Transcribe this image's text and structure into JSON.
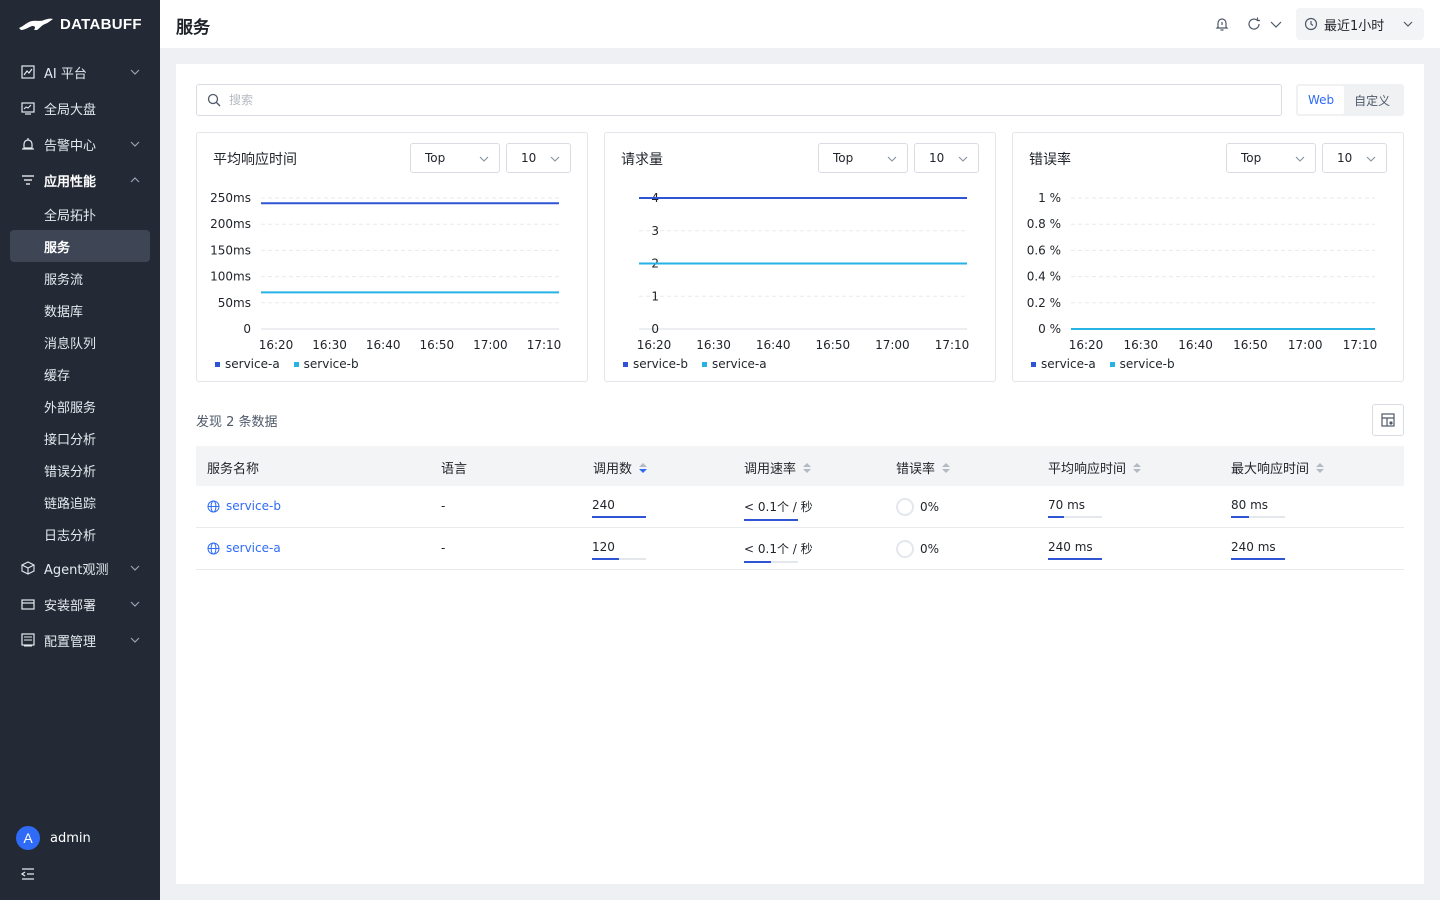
{
  "brand": {
    "name": "DATABUFF"
  },
  "sidebar": {
    "items": [
      {
        "label": "AI 平台",
        "icon": "chart-icon",
        "expandable": true
      },
      {
        "label": "全局大盘",
        "icon": "dashboard-icon",
        "expandable": false
      },
      {
        "label": "告警中心",
        "icon": "alarm-icon",
        "expandable": true
      },
      {
        "label": "应用性能",
        "icon": "apm-icon",
        "expandable": true,
        "open": true
      },
      {
        "label": "Agent观测",
        "icon": "cube-icon",
        "expandable": true
      },
      {
        "label": "安装部署",
        "icon": "deploy-icon",
        "expandable": true
      },
      {
        "label": "配置管理",
        "icon": "config-icon",
        "expandable": true
      }
    ],
    "subitems": [
      "全局拓扑",
      "服务",
      "服务流",
      "数据库",
      "消息队列",
      "缓存",
      "外部服务",
      "接口分析",
      "错误分析",
      "链路追踪",
      "日志分析"
    ],
    "active_subitem": "服务",
    "user": {
      "initial": "A",
      "name": "admin"
    }
  },
  "header": {
    "title": "服务",
    "time_range": "最近1小时"
  },
  "search": {
    "placeholder": "搜索"
  },
  "segment": {
    "options": [
      "Web",
      "自定义"
    ],
    "active": "Web"
  },
  "charts": [
    {
      "title": "平均响应时间",
      "top_label": "Top",
      "top_n": "10",
      "chart_data": {
        "type": "line",
        "x": [
          "16:20",
          "16:30",
          "16:40",
          "16:50",
          "17:00",
          "17:10"
        ],
        "yticks": [
          "0",
          "50ms",
          "100ms",
          "150ms",
          "200ms",
          "250ms"
        ],
        "ylim": [
          0,
          250
        ],
        "series": [
          {
            "name": "service-a",
            "color": "#2f55d4",
            "value": 240
          },
          {
            "name": "service-b",
            "color": "#27b2e6",
            "value": 70
          }
        ]
      }
    },
    {
      "title": "请求量",
      "top_label": "Top",
      "top_n": "10",
      "chart_data": {
        "type": "line",
        "x": [
          "16:20",
          "16:30",
          "16:40",
          "16:50",
          "17:00",
          "17:10"
        ],
        "yticks": [
          "0",
          "1",
          "2",
          "3",
          "4"
        ],
        "ylim": [
          0,
          4
        ],
        "series": [
          {
            "name": "service-b",
            "color": "#2f55d4",
            "value": 4
          },
          {
            "name": "service-a",
            "color": "#27b2e6",
            "value": 2
          }
        ]
      }
    },
    {
      "title": "错误率",
      "top_label": "Top",
      "top_n": "10",
      "chart_data": {
        "type": "line",
        "x": [
          "16:20",
          "16:30",
          "16:40",
          "16:50",
          "17:00",
          "17:10"
        ],
        "yticks": [
          "0 %",
          "0.2 %",
          "0.4 %",
          "0.6 %",
          "0.8 %",
          "1 %"
        ],
        "ylim": [
          0,
          1
        ],
        "series": [
          {
            "name": "service-a",
            "color": "#2f55d4",
            "value": 0
          },
          {
            "name": "service-b",
            "color": "#27b2e6",
            "value": 0
          }
        ]
      }
    }
  ],
  "table": {
    "found": "发现 2 条数据",
    "columns": [
      "服务名称",
      "语言",
      "调用数",
      "调用速率",
      "错误率",
      "平均响应时间",
      "最大响应时间"
    ],
    "rows": [
      {
        "name": "service-b",
        "lang": "-",
        "calls": "240",
        "calls_frac": 1.0,
        "rate": "< 0.1个 / 秒",
        "rate_frac": 1.0,
        "err": "0%",
        "avg": "70 ms",
        "avg_frac": 0.29,
        "max": "80 ms",
        "max_frac": 0.33
      },
      {
        "name": "service-a",
        "lang": "-",
        "calls": "120",
        "calls_frac": 0.5,
        "rate": "< 0.1个 / 秒",
        "rate_frac": 0.5,
        "err": "0%",
        "avg": "240 ms",
        "avg_frac": 1.0,
        "max": "240 ms",
        "max_frac": 1.0
      }
    ]
  },
  "colors": {
    "accent": "#2f6bf6",
    "series_1": "#2f55d4",
    "series_2": "#27b2e6",
    "sidebar_bg": "#232a36"
  }
}
